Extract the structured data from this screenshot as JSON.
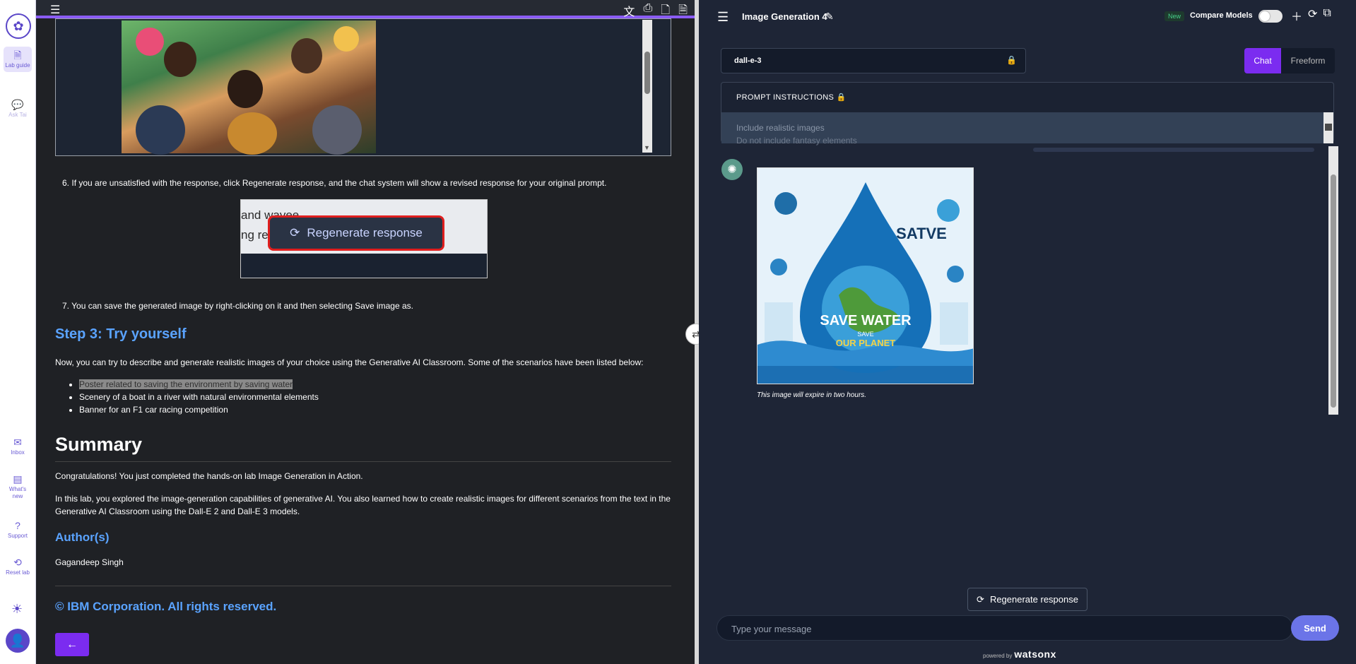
{
  "rail": {
    "items": [
      {
        "label": "Lab guide",
        "icon": "document-icon"
      },
      {
        "label": "Ask Tai",
        "icon": "chat-icon"
      },
      {
        "label": "Inbox",
        "icon": "inbox-icon"
      },
      {
        "label": "What's new",
        "icon": "news-icon"
      },
      {
        "label": "Support",
        "icon": "help-icon"
      },
      {
        "label": "Reset lab",
        "icon": "reset-icon"
      }
    ]
  },
  "lab": {
    "step6": "If you are unsatisfied with the response, click Regenerate response, and the chat system will show a revised response for your original prompt.",
    "step6_num": "6.",
    "shot": {
      "text1": "and wavee",
      "text2": "ng re",
      "button": "Regenerate response"
    },
    "step7_num": "7.",
    "step7": "You can save the generated image by right-clicking on it and then selecting Save image as.",
    "step3_heading": "Step 3: Try yourself",
    "step3_text": "Now, you can try to describe and generate realistic images of your choice using the Generative AI Classroom. Some of the scenarios have been listed below:",
    "bullets": [
      "Poster related to saving the environment by saving water",
      "Scenery of a boat in a river with natural environmental elements",
      "Banner for an F1 car racing competition"
    ],
    "summary_heading": "Summary",
    "summary_p1": "Congratulations! You just completed the hands-on lab Image Generation in Action.",
    "summary_p2": "In this lab, you explored the image-generation capabilities of generative AI. You also learned how to create realistic images for different scenarios from the text in the Generative AI Classroom using the Dall-E 2 and Dall-E 3 models.",
    "authors_heading": "Author(s)",
    "author": "Gagandeep Singh",
    "copyright": "© IBM Corporation. All rights reserved.",
    "back_label": "←"
  },
  "chat": {
    "title": "Image Generation 4",
    "new_badge": "New",
    "compare_label": "Compare Models",
    "model": "dall-e-3",
    "modes": [
      "Chat",
      "Freeform"
    ],
    "active_mode": "Chat",
    "prompt_label": "PROMPT INSTRUCTIONS",
    "prompt_lines": [
      "Include realistic images",
      "Do not include fantasy elements"
    ],
    "image_texts": {
      "main": "SAVE WATER",
      "sub1": "SAVE",
      "sub2": "OUR PLANET",
      "corner": "SATVE"
    },
    "caption": "This image will expire in two hours.",
    "regenerate": "Regenerate response",
    "input_placeholder": "Type your message",
    "send": "Send",
    "powered_prefix": "powered by",
    "powered_brand": "watsonx"
  },
  "colors": {
    "accent": "#7b2cf0",
    "heading_blue": "#5aa3ff",
    "send": "#6b74e8"
  }
}
